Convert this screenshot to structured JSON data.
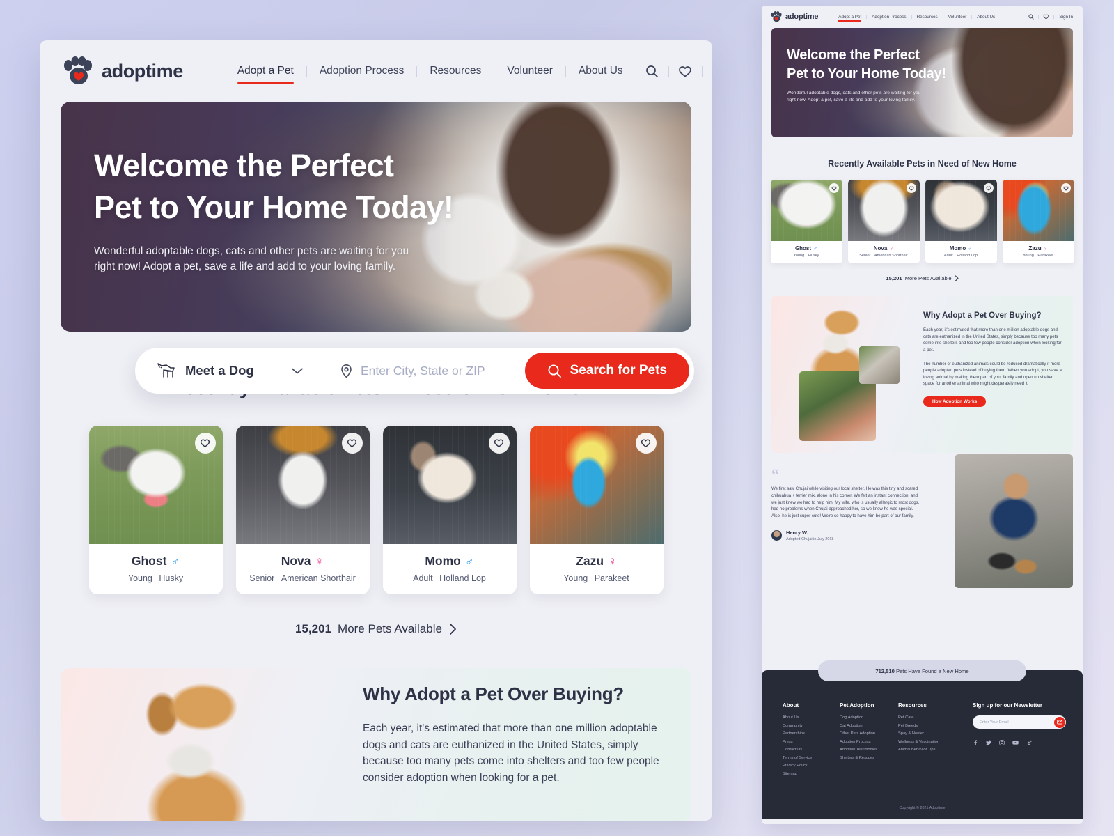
{
  "brand": {
    "name": "adoptime",
    "accent": "#e8291c",
    "dark": "#2e3246",
    "footer_bg": "#272a37"
  },
  "header": {
    "nav": [
      "Adopt a Pet",
      "Adoption Process",
      "Resources",
      "Volunteer",
      "About Us"
    ],
    "active_nav": "Adopt a Pet",
    "search_icon": "search-icon",
    "favorite_icon": "heart-icon",
    "signin_label": "Sign In"
  },
  "hero": {
    "title_line1": "Welcome the Perfect",
    "title_line2": "Pet to Your Home Today!",
    "paragraph_line1": "Wonderful adoptable dogs, cats and other pets are waiting for you",
    "paragraph_line2": "right now! Adopt a pet, save a life and add to your loving family."
  },
  "search": {
    "pet_type_value": "Meet a Dog",
    "pet_type_icon": "dog-icon",
    "chevron_icon": "chevron-down-icon",
    "location_icon": "map-pin-icon",
    "location_placeholder": "Enter City, State or ZIP",
    "button_label": "Search for Pets",
    "button_icon": "search-icon"
  },
  "pets_section": {
    "title": "Recently Available Pets in Need of New Home",
    "cards": [
      {
        "name": "Ghost",
        "gender": "male",
        "gender_glyph": "♂",
        "age": "Young",
        "breed": "Husky",
        "photo": "ghost"
      },
      {
        "name": "Nova",
        "gender": "female",
        "gender_glyph": "♀",
        "age": "Senior",
        "breed": "American Shorthair",
        "photo": "nova"
      },
      {
        "name": "Momo",
        "gender": "male",
        "gender_glyph": "♂",
        "age": "Adult",
        "breed": "Holland Lop",
        "photo": "momo"
      },
      {
        "name": "Zazu",
        "gender": "female",
        "gender_glyph": "♀",
        "age": "Young",
        "breed": "Parakeet",
        "photo": "zazu"
      }
    ],
    "more_count": "15,201",
    "more_label": "More Pets Available",
    "more_icon": "chevron-right-icon"
  },
  "why": {
    "title": "Why Adopt a Pet Over Buying?",
    "paragraph1": "Each year, it's estimated that more than one million adoptable dogs and cats are euthanized in the United States, simply because too many pets come into shelters and too few people consider adoption when looking for a pet.",
    "paragraph2": "The number of euthanized animals could be reduced dramatically if more people adopted pets instead of buying them. When you adopt, you save a loving animal by making them part of your family and open up shelter space for another animal who might desperately need it.",
    "button_label": "How Adoption Works"
  },
  "testimonial": {
    "quote_mark": "“",
    "text": "We first saw Chujai while visiting our local shelter. He was this tiny and scared chihuahua + terrier mix, alone in his corner. We felt an instant connection, and we just knew we had to help him. My wife, who is usually allergic to most dogs, had no problems when Chujai approached her, so we know he was special. Also, he is just super cute! We're so happy to have him be part of our family.",
    "author": "Henry W.",
    "author_sub": "Adopted Chujai in July 2018"
  },
  "counter": {
    "number": "712,510",
    "label": "Pets Have Found a New Home"
  },
  "footer": {
    "columns": [
      {
        "heading": "About",
        "links": [
          "About Us",
          "Community",
          "Partnerships",
          "Press",
          "Contact Us",
          "Terms of Service",
          "Privacy Policy",
          "Sitemap"
        ]
      },
      {
        "heading": "Pet Adoption",
        "links": [
          "Dog Adoption",
          "Cat Adoption",
          "Other Pets Adoption",
          "Adoption Process",
          "Adoption Testimonies",
          "Shelters & Rescues"
        ]
      },
      {
        "heading": "Resources",
        "links": [
          "Pet Care",
          "Pet Breeds",
          "Spay & Neuter",
          "Wellness & Vaccination",
          "Animal Behavior Tips"
        ]
      }
    ],
    "newsletter": {
      "heading": "Sign up for our Newsletter",
      "placeholder": "Enter Your Email",
      "submit_icon": "mail-icon"
    },
    "social": [
      "facebook-icon",
      "twitter-icon",
      "instagram-icon",
      "youtube-icon",
      "tiktok-icon"
    ],
    "copyright": "Copyright © 2021 Adoptime"
  }
}
